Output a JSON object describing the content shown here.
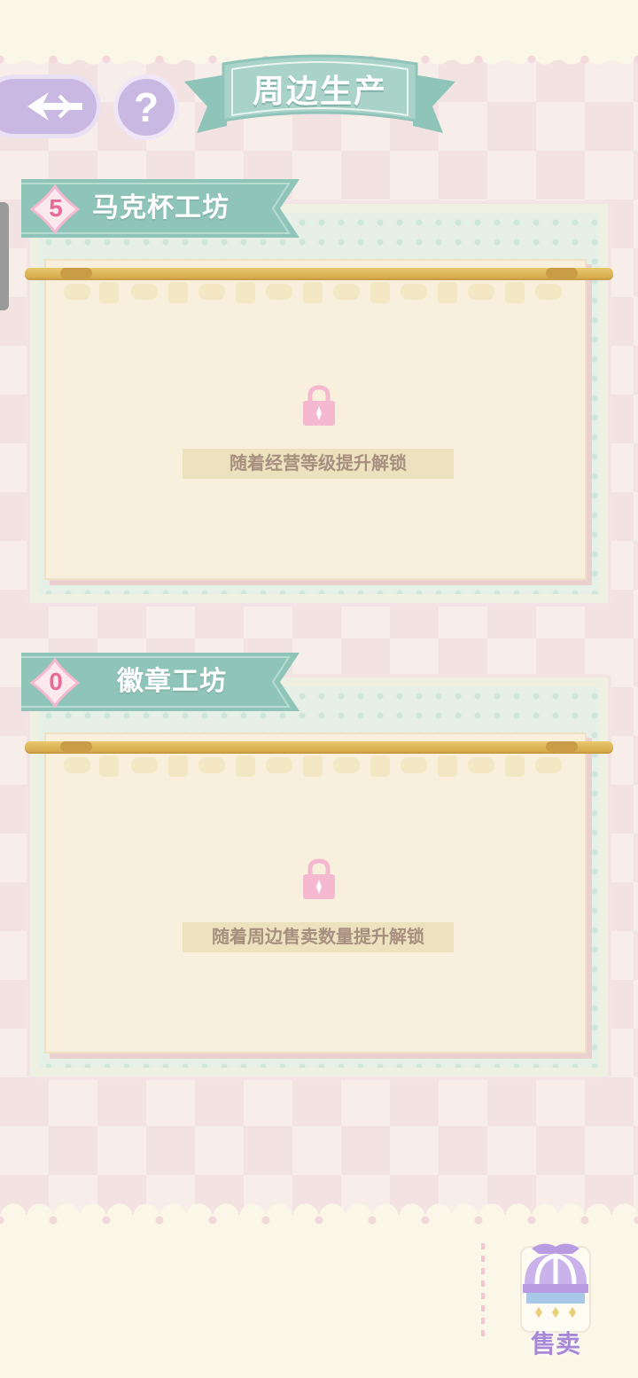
{
  "header": {
    "title": "周边生产",
    "back_icon": "back-arrow-icon",
    "help_label": "?"
  },
  "workshops": [
    {
      "level": "5",
      "name": "马克杯工坊",
      "unlock_text": "随着经营等级提升解锁",
      "locked": true
    },
    {
      "level": "0",
      "name": "徽章工坊",
      "unlock_text": "随着周边售卖数量提升解锁",
      "locked": true
    }
  ],
  "footer": {
    "sell_label": "售卖"
  },
  "colors": {
    "accent_teal": "#8fc4b8",
    "accent_purple": "#c9b8e2",
    "lock_pink": "#f4b9cf",
    "level_pink": "#e86a97"
  }
}
